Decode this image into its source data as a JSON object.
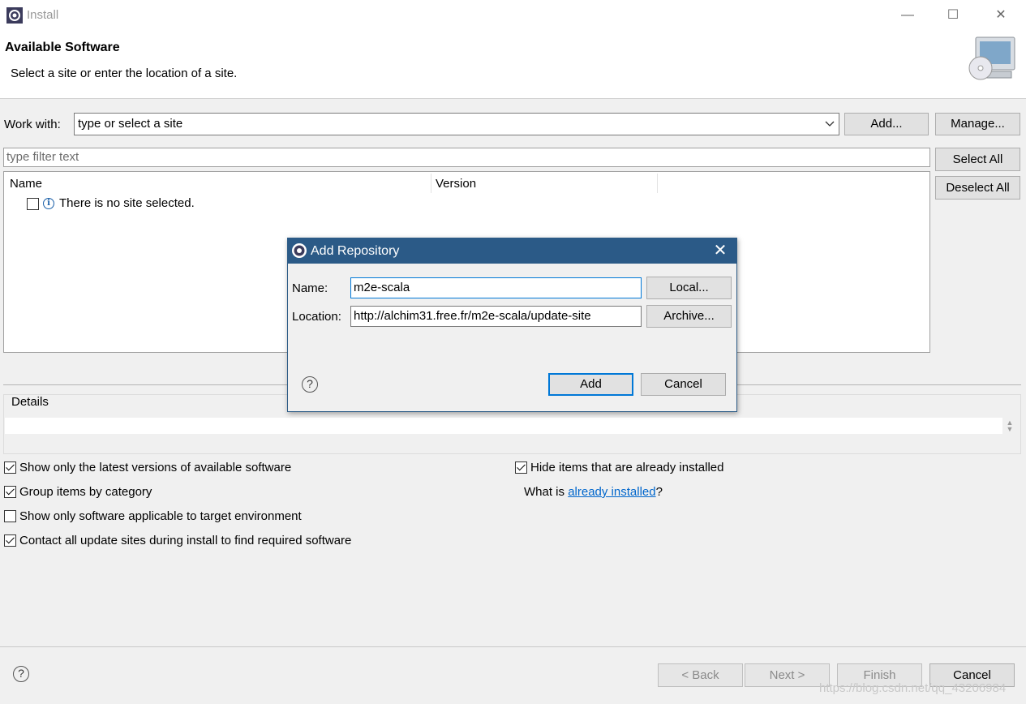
{
  "window": {
    "title": "Install"
  },
  "header": {
    "title": "Available Software",
    "description": "Select a site or enter the location of a site."
  },
  "work_with": {
    "label": "Work with:",
    "value": "type or select a site",
    "add_label": "Add...",
    "manage_label": "Manage..."
  },
  "filter": {
    "placeholder": "type filter text"
  },
  "buttons": {
    "select_all": "Select All",
    "deselect_all": "Deselect All"
  },
  "tree": {
    "columns": [
      "Name",
      "Version"
    ],
    "rows": [
      {
        "label": "There is no site selected.",
        "checked": false
      }
    ]
  },
  "details": {
    "label": "Details"
  },
  "options": {
    "show_latest": {
      "label": "Show only the latest versions of available software",
      "checked": true
    },
    "group_by_category": {
      "label": "Group items by category",
      "checked": true
    },
    "show_applicable": {
      "label": "Show only software applicable to target environment",
      "checked": false
    },
    "contact_sites": {
      "label": "Contact all update sites during install to find required software",
      "checked": true
    },
    "hide_installed": {
      "label": "Hide items that are already installed",
      "checked": true
    },
    "what_is_prefix": "What is ",
    "what_is_link": "already installed",
    "what_is_suffix": "?"
  },
  "footer": {
    "back": "< Back",
    "next": "Next >",
    "finish": "Finish",
    "cancel": "Cancel"
  },
  "dialog": {
    "title": "Add Repository",
    "name_label": "Name:",
    "name_value": "m2e-scala",
    "location_label": "Location:",
    "location_value": "http://alchim31.free.fr/m2e-scala/update-site",
    "local_label": "Local...",
    "archive_label": "Archive...",
    "add_label": "Add",
    "cancel_label": "Cancel"
  },
  "watermark": "https://blog.csdn.net/qq_43206984",
  "colors": {
    "dialog_titlebar": "#2b5a87",
    "link": "#0066cc",
    "primary_border": "#0078d7"
  }
}
